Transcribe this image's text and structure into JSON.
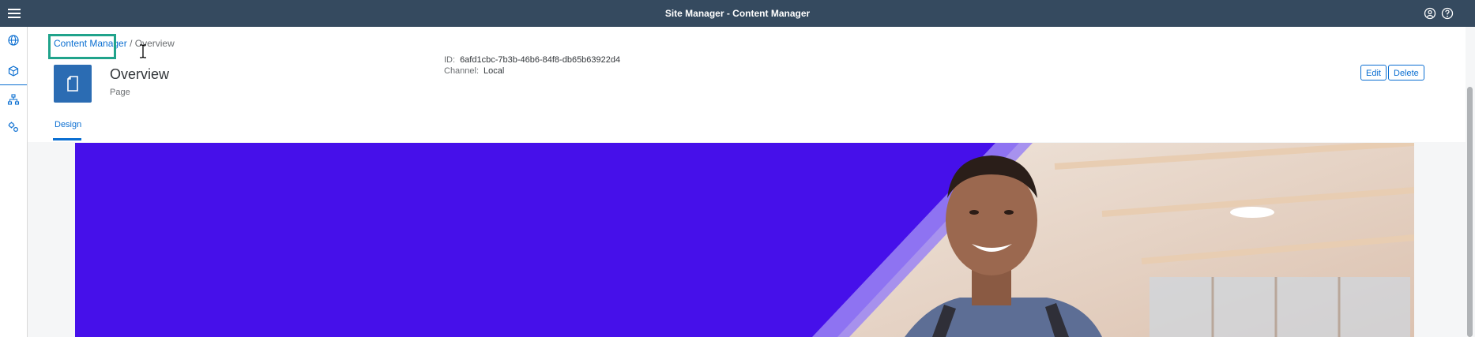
{
  "shell": {
    "title": "Site Manager - Content Manager",
    "menu_icon": "hamburger-menu-icon",
    "user_icon": "user-profile-icon",
    "help_icon": "help-icon"
  },
  "sidenav": {
    "items": [
      {
        "icon": "globe-icon",
        "active": false
      },
      {
        "icon": "content-cube-icon",
        "active": true
      },
      {
        "icon": "hierarchy-icon",
        "active": false
      },
      {
        "icon": "settings-gears-icon",
        "active": false
      }
    ]
  },
  "breadcrumb": {
    "link": "Content Manager",
    "separator": "/",
    "current": "Overview"
  },
  "object": {
    "icon": "document-icon",
    "title": "Overview",
    "subtitle": "Page",
    "id_label": "ID:",
    "id_value": "6afd1cbc-7b3b-46b6-84f8-db65b63922d4",
    "channel_label": "Channel:",
    "channel_value": "Local"
  },
  "actions": {
    "edit": "Edit",
    "delete": "Delete"
  },
  "tabs": [
    {
      "label": "Design",
      "selected": true
    }
  ],
  "colors": {
    "shell": "#354a5f",
    "accent": "#0a6ed1",
    "banner": "#4610ea",
    "focus": "#20a38b"
  }
}
